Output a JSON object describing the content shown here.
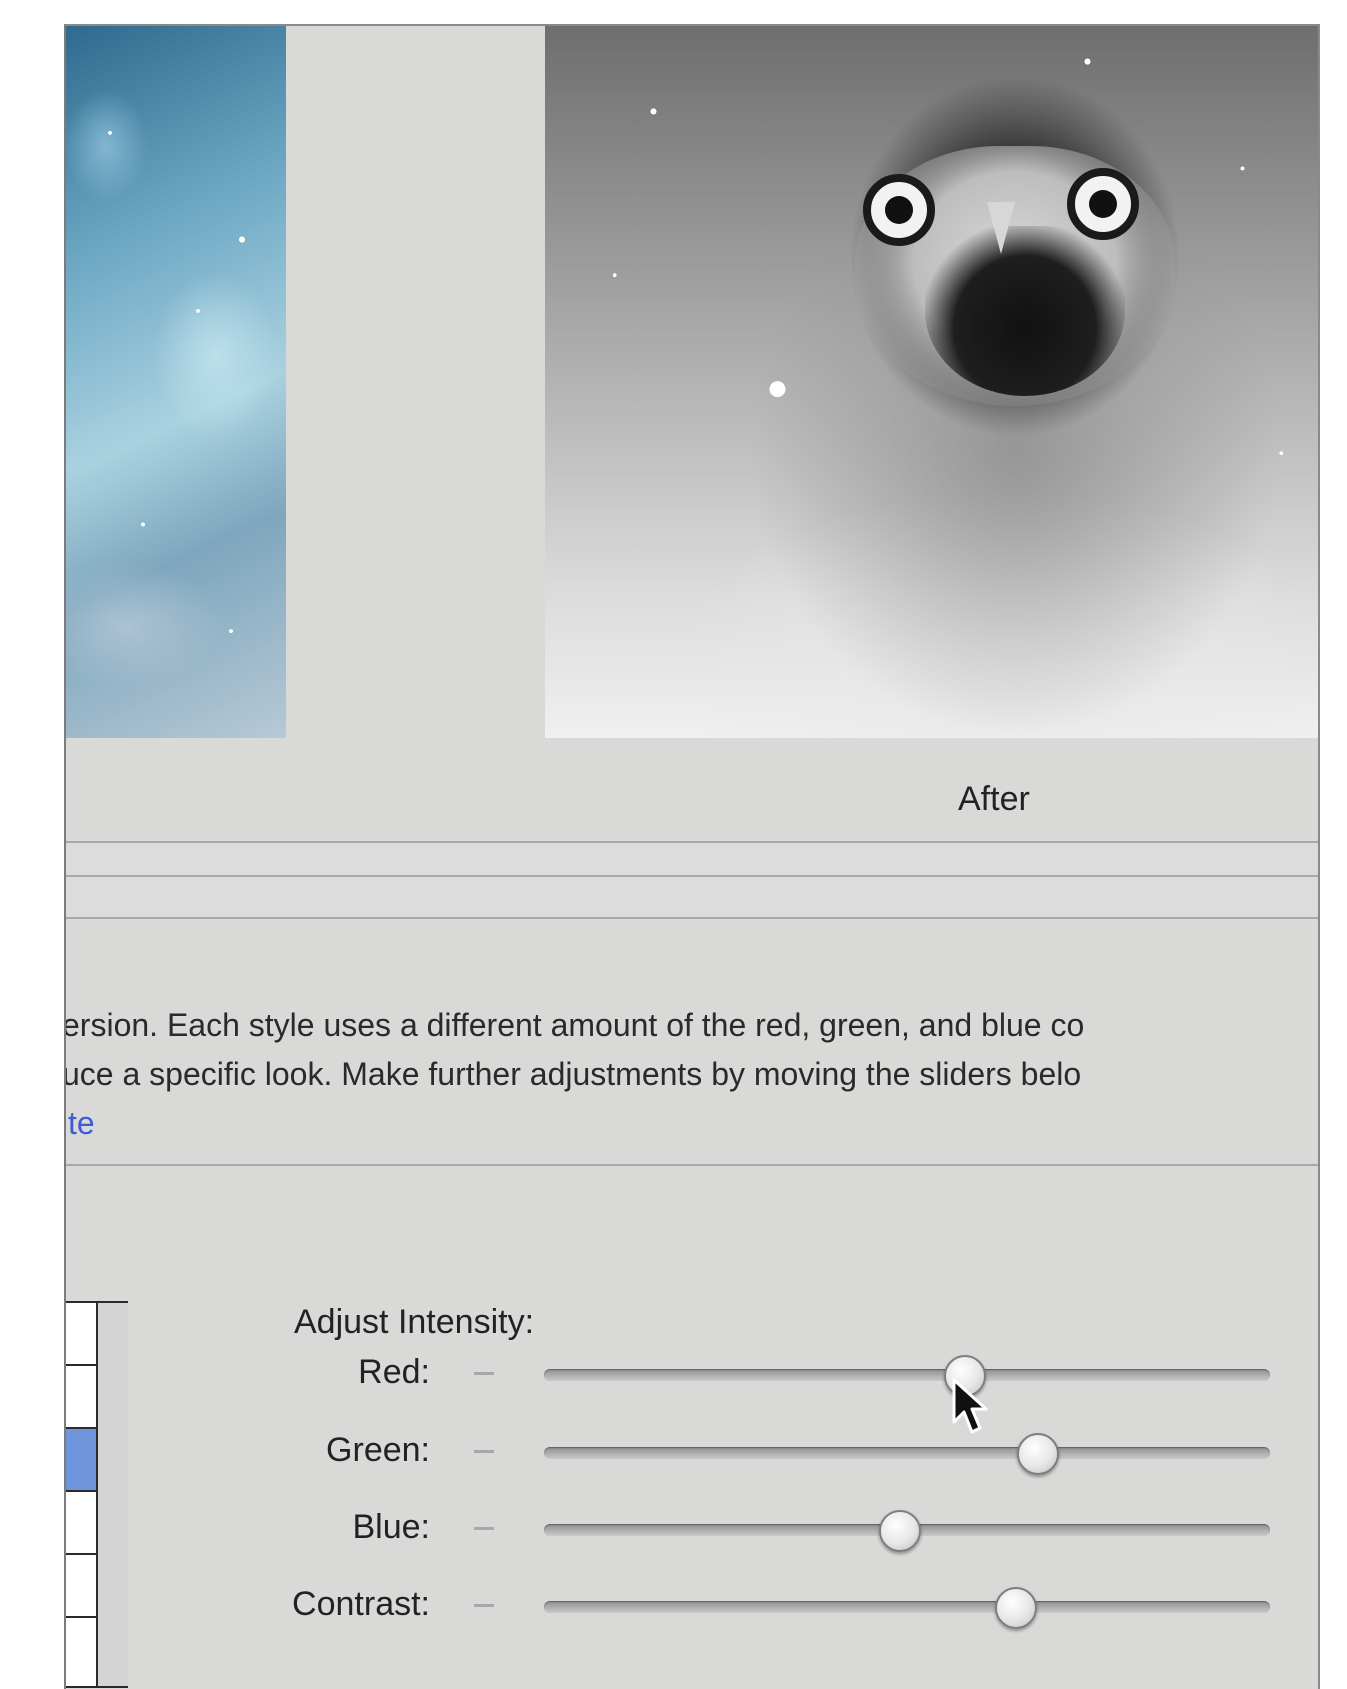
{
  "preview": {
    "after_label": "After"
  },
  "description": {
    "line1": "ersion. Each style uses a different amount of the red, green, and blue co",
    "line2": "uce a specific look. Make further adjustments by moving the sliders belo",
    "link": "te"
  },
  "adjust": {
    "title": "Adjust Intensity:",
    "sliders": [
      {
        "label": "Red:",
        "value": 0.58
      },
      {
        "label": "Green:",
        "value": 0.68
      },
      {
        "label": "Blue:",
        "value": 0.49
      },
      {
        "label": "Contrast:",
        "value": 0.65
      }
    ]
  },
  "styles_list": {
    "selected_index": 2
  },
  "colors": {
    "link": "#3e5bd8",
    "selected_swatch": "#6f96dc",
    "panel_bg": "#d9d9d7"
  }
}
